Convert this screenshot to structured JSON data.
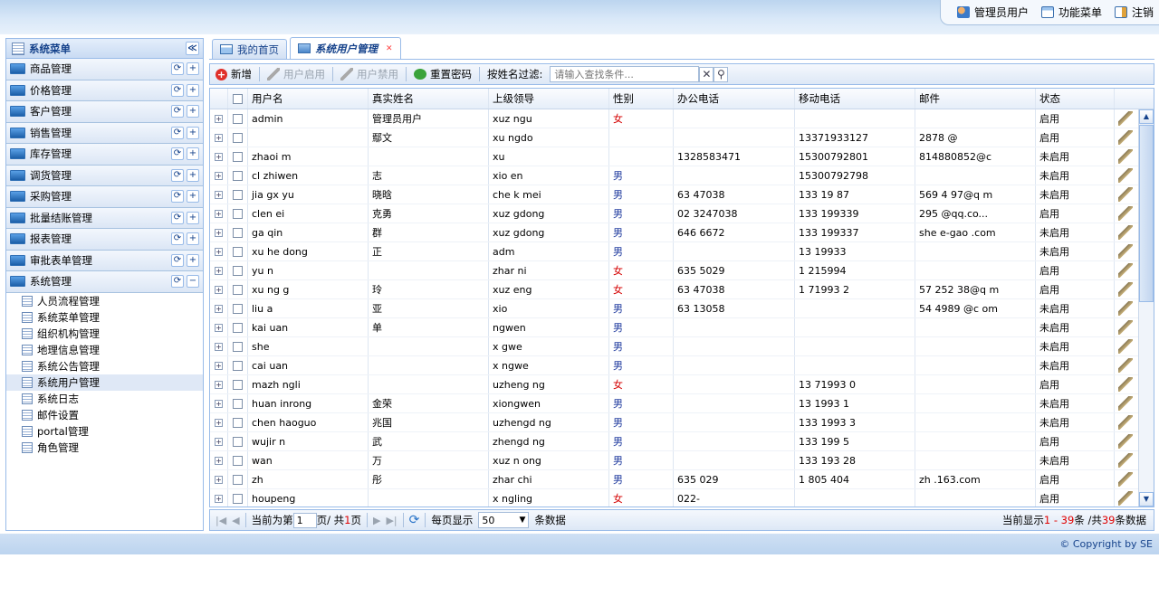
{
  "topbar": {
    "user": "管理员用户",
    "func_menu": "功能菜单",
    "logout": "注销"
  },
  "sidebar": {
    "title": "系统菜单",
    "collapse": "≪",
    "menus": [
      "商品管理",
      "价格管理",
      "客户管理",
      "销售管理",
      "库存管理",
      "调货管理",
      "采购管理",
      "批量结账管理",
      "报表管理",
      "审批表单管理",
      "系统管理"
    ],
    "submenus": [
      "人员流程管理",
      "系统菜单管理",
      "组织机构管理",
      "地理信息管理",
      "系统公告管理",
      "系统用户管理",
      "系统日志",
      "邮件设置",
      "portal管理",
      "角色管理"
    ],
    "active_submenu": "系统用户管理"
  },
  "tabs": [
    {
      "label": "我的首页"
    },
    {
      "label": "系统用户管理"
    }
  ],
  "toolbar": {
    "add": "新增",
    "enable": "用户启用",
    "disable": "用户禁用",
    "reset": "重置密码",
    "filter_label": "按姓名过滤:",
    "search_placeholder": "请输入查找条件..."
  },
  "grid": {
    "columns": [
      "用户名",
      "真实姓名",
      "上级领导",
      "性别",
      "办公电话",
      "移动电话",
      "邮件",
      "状态"
    ],
    "rows": [
      [
        "admin",
        "管理员用户",
        "xuz  ngu  ",
        "女",
        "",
        "",
        "",
        "启用"
      ],
      [
        "",
        "鄢文",
        "xu  ngdo  ",
        "",
        "",
        "13371933127",
        "2878   @   ",
        "启用"
      ],
      [
        "zhaoi   m",
        "",
        "xu    ",
        "",
        "1328583471",
        "15300792801",
        "814880852@c    ",
        "未启用"
      ],
      [
        "cl   zhiwen",
        "志",
        "xio   en",
        "男",
        "",
        "15300792798",
        "",
        "未启用"
      ],
      [
        "jia gx   yu",
        "晓晗",
        "che  k mei",
        "男",
        "63  47038",
        "133 19   87",
        "569  4  97@q  m",
        "未启用"
      ],
      [
        "clen  ei",
        "克勇",
        "xuz   gdong",
        "男",
        "02  3247038",
        "133 199339",
        "295   @qq.co...",
        "启用"
      ],
      [
        "ga qin",
        "群",
        "xuz  gdong",
        "男",
        "646  6672",
        "133 199337",
        "she   e-gao  .com",
        "未启用"
      ],
      [
        "xu he   dong",
        "正",
        "adm",
        "男",
        "",
        "13   19933",
        "",
        "未启用"
      ],
      [
        "yu   n",
        "",
        "zhar   ni",
        "女",
        "635  5029",
        "1  215994 ",
        "",
        "启用"
      ],
      [
        "xu ng  g",
        "玲",
        "xuz  eng  ",
        "女",
        "63  47038",
        "1  71993  2",
        "57  252  38@q  m",
        "启用"
      ],
      [
        "liu   a",
        "亚",
        "xio   ",
        "男",
        "63  13058",
        "",
        "54  4989  @c  om",
        "未启用"
      ],
      [
        "kai    uan",
        "单",
        "  ngwen",
        "男",
        "",
        "",
        "",
        "未启用"
      ],
      [
        "she",
        "",
        "x  gwe",
        "男",
        "",
        "",
        "",
        "未启用"
      ],
      [
        "cai   uan",
        "",
        "x  ngwe",
        "男",
        "",
        "",
        "",
        "未启用"
      ],
      [
        "mazh  ngli",
        "",
        "  uzheng  ng",
        "女",
        "",
        "13  71993  0",
        "",
        "启用"
      ],
      [
        "huan   inrong",
        "金荣",
        "xiongwen",
        "男",
        "",
        "13  1993  1",
        "",
        "未启用"
      ],
      [
        "chen  haoguo",
        "兆国",
        "  uzhengd  ng",
        "男",
        "",
        "133  1993  3",
        "",
        "未启用"
      ],
      [
        "wujir  n",
        "武",
        "  zhengd  ng",
        "男",
        "",
        "133  199  5",
        "",
        "启用"
      ],
      [
        "wan",
        "万",
        "xuz   n  ong",
        "男",
        "",
        "133  193  28",
        "",
        "未启用"
      ],
      [
        "zh",
        "彤",
        "zhar   chi",
        "男",
        "635  029",
        "1  805  404",
        "zh      .163.com",
        "启用"
      ],
      [
        "houpeng",
        "",
        "x  ngling",
        "女",
        "022-       ",
        "",
        "",
        "启用"
      ]
    ]
  },
  "pager": {
    "current_prefix": "当前为第",
    "page": "1",
    "page_mid": "页/ 共",
    "total_pages": "1",
    "page_suffix": "页",
    "per_page_label": "每页显示",
    "per_page": "50",
    "per_page_suffix": "条数据",
    "info_prefix": "当前显示",
    "range": "1 - 39",
    "info_mid": "条 /共",
    "total": "39",
    "info_suffix": "条数据"
  },
  "footer": {
    "copyright": "© Copyright by SE"
  }
}
